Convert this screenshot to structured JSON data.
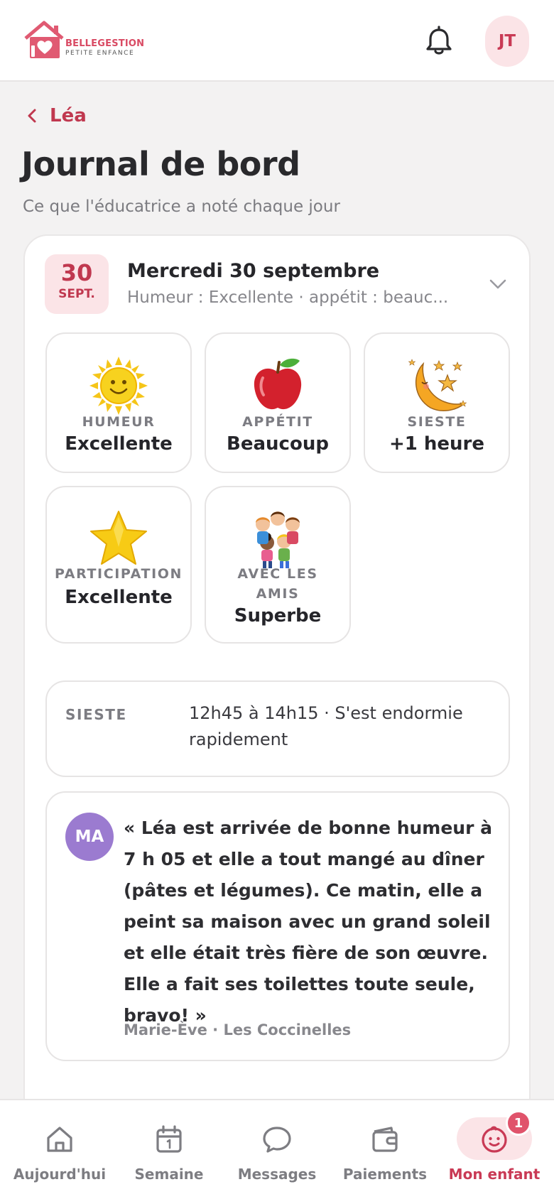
{
  "header": {
    "logo": {
      "brand": "BELLEGESTION",
      "tagline": "PETITE ENFANCE"
    },
    "avatar_initials": "JT"
  },
  "back": {
    "label": "Léa"
  },
  "page": {
    "title": "Journal de bord",
    "subtitle": "Ce que l'éducatrice a noté chaque jour"
  },
  "entry": {
    "day": "30",
    "month": "SEPT.",
    "title": "Mercredi 30 septembre",
    "summary": "Humeur : Excellente · appétit : beauc...",
    "tiles": [
      {
        "icon": "sun-icon",
        "label": "HUMEUR",
        "value": "Excellente"
      },
      {
        "icon": "apple-icon",
        "label": "APPÉTIT",
        "value": "Beaucoup"
      },
      {
        "icon": "moon-icon",
        "label": "SIESTE",
        "value": "+1 heure"
      },
      {
        "icon": "star-icon",
        "label": "PARTICIPATION",
        "value": "Excellente"
      },
      {
        "icon": "kids-icon",
        "label": "AVEC LES AMIS",
        "value": "Superbe"
      }
    ],
    "nap": {
      "label": "SIESTE",
      "value": "12h45 à 14h15 · S'est endormie rapidement"
    },
    "note": {
      "initials": "MA",
      "text": "« Léa est arrivée de bonne humeur à 7 h 05 et elle a tout mangé au dîner (pâtes et légumes). Ce matin, elle a peint sa maison avec un grand soleil et elle était très fière de son œuvre. Elle a fait ses toilettes toute seule, bravo! »",
      "author": "Marie-Ève · Les Coccinelles"
    }
  },
  "nav": {
    "items": [
      {
        "label": "Aujourd'hui",
        "icon": "home-icon"
      },
      {
        "label": "Semaine",
        "icon": "calendar-icon"
      },
      {
        "label": "Messages",
        "icon": "chat-icon"
      },
      {
        "label": "Paiements",
        "icon": "wallet-icon"
      },
      {
        "label": "Mon enfant",
        "icon": "child-face-icon"
      }
    ],
    "active_index": 4,
    "badge_count": "1"
  },
  "colors": {
    "accent": "#c93a55",
    "accent_soft": "#fbe4e7",
    "note_avatar": "#9b7bd0",
    "background": "#f3f2f2"
  }
}
